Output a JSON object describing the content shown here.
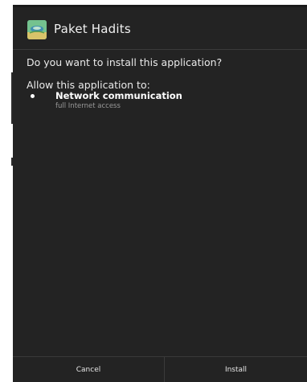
{
  "dialog": {
    "app_name": "Paket Hadits",
    "app_icon": "app-icon",
    "question": "Do you want to install this application?",
    "permissions_header": "Allow this application to:",
    "permissions": [
      {
        "title": "Network communication",
        "description": "full Internet access"
      }
    ]
  },
  "buttons": {
    "cancel_label": "Cancel",
    "install_label": "Install"
  },
  "colors": {
    "dialog_background": "#232323",
    "divider": "#3a3a3a",
    "text_primary": "#eaeaea",
    "text_secondary": "#9a9a9a"
  }
}
